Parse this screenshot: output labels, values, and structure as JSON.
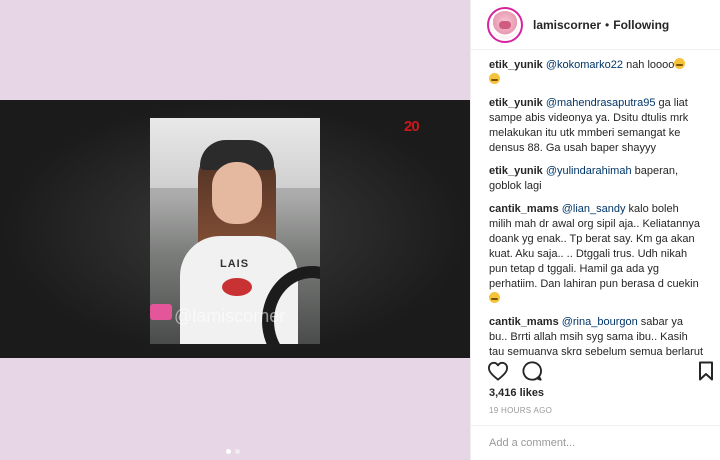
{
  "post": {
    "username": "lamiscorner",
    "separator": "•",
    "follow_status": "Following",
    "likes": "3,416 likes",
    "timestamp": "19 HOURS AGO",
    "add_comment_placeholder": "Add a comment..."
  },
  "media": {
    "watermark": "@lamiscorner",
    "channel_logo": "20",
    "shirt_text": "LAIS",
    "carousel_dots": 2,
    "active_dot": 1
  },
  "comments": [
    {
      "user": "etik_yunik",
      "mention": "@kokomarko22",
      "text": " nah loooo",
      "emoji": "weary-face-emoji",
      "emoji_on_new_line": true
    },
    {
      "user": "etik_yunik",
      "mention": "@mahendrasaputra95",
      "text": " ga liat sampe abis videonya ya. Dsitu dtulis mrk melakukan itu utk mmberi semangat ke densus 88. Ga usah baper shayyy"
    },
    {
      "user": "etik_yunik",
      "mention": "@yulindarahimah",
      "text": " baperan, goblok lagi"
    },
    {
      "user": "cantik_mams",
      "mention": "@lian_sandy",
      "text": " kalo boleh milih mah dr awal org sipil aja.. Keliatannya doank yg enak.. Tp berat say. Km ga akan kuat. Aku saja.. .. Dtggali trus. Udh nikah pun tetap d tggali. Hamil ga ada yg perhatiim. Dan lahiran pun berasa d cuekin",
      "emoji": "sad-face-emoji",
      "emoji_on_new_line": true
    },
    {
      "user": "cantik_mams",
      "mention": "@rina_bourgon",
      "text": " sabar ya bu.. Brrti allah msih syg sama ibu.. Kasih tau semuanya skrg sebelum semua berlarut larut.."
    }
  ],
  "colors": {
    "mention": "#003569",
    "media_background": "#e7d7e6",
    "channel_logo": "#c81a1a"
  }
}
